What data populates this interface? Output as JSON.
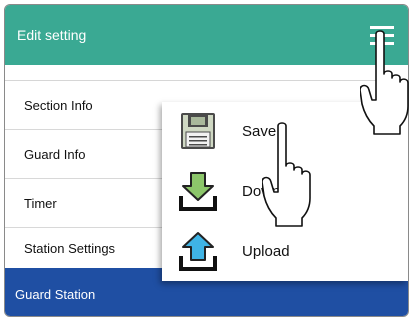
{
  "header": {
    "title": "Edit setting",
    "menu_icon": "hamburger-menu-icon",
    "color": "#3aa993"
  },
  "list": {
    "items": [
      {
        "label": "Section Info"
      },
      {
        "label": "Guard Info"
      },
      {
        "label": "Timer"
      },
      {
        "label": "Station Settings"
      }
    ]
  },
  "footer": {
    "label": "Guard Station",
    "color": "#1f4fa3"
  },
  "menu": {
    "items": [
      {
        "label": "Save",
        "icon": "floppy-disk-icon"
      },
      {
        "label": "Download",
        "icon": "download-arrow-icon"
      },
      {
        "label": "Upload",
        "icon": "upload-arrow-icon"
      }
    ]
  }
}
